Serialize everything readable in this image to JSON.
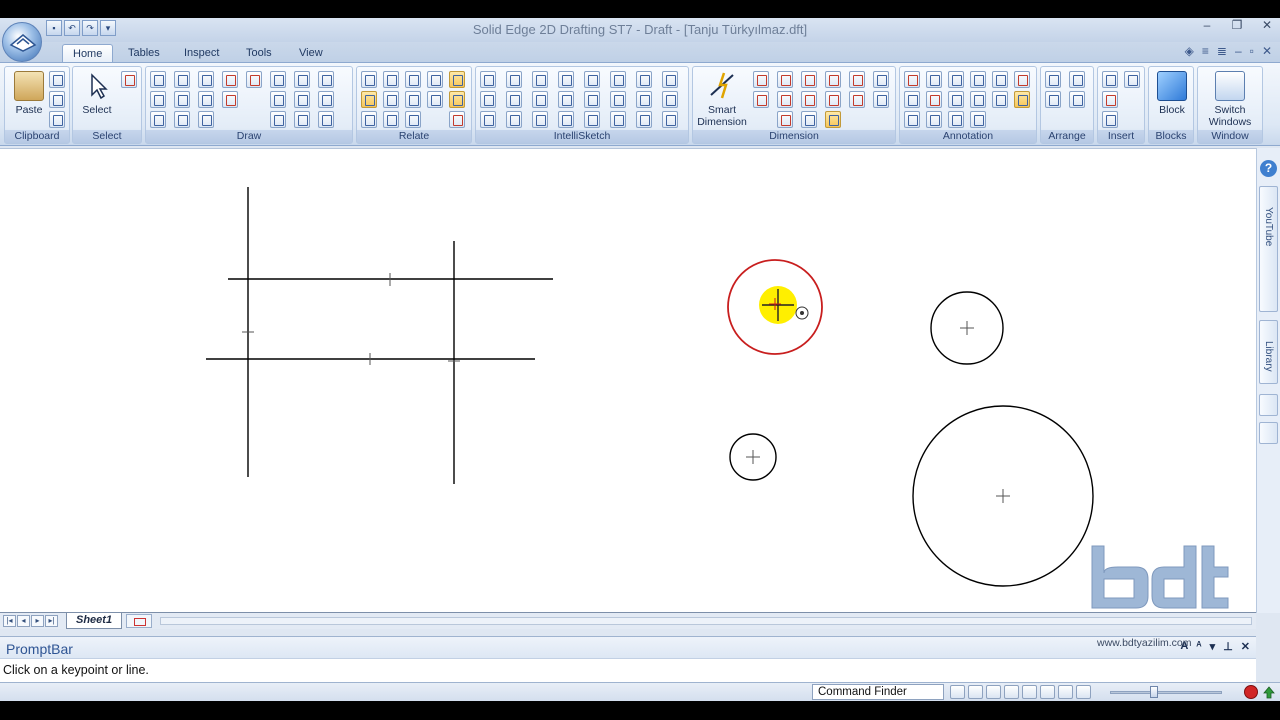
{
  "window": {
    "title": "Solid Edge 2D Drafting ST7 - Draft - [Tanju Türkyılmaz.dft]"
  },
  "tabs": [
    {
      "label": "Home",
      "active": true
    },
    {
      "label": "Tables",
      "active": false
    },
    {
      "label": "Inspect",
      "active": false
    },
    {
      "label": "Tools",
      "active": false
    },
    {
      "label": "View",
      "active": false
    }
  ],
  "ribbon": {
    "clipboard": {
      "label": "Clipboard",
      "paste": "Paste"
    },
    "select": {
      "label": "Select",
      "select": "Select"
    },
    "draw": {
      "label": "Draw"
    },
    "relate": {
      "label": "Relate"
    },
    "intellisketch": {
      "label": "IntelliSketch"
    },
    "dimension": {
      "label": "Dimension",
      "smart1": "Smart",
      "smart2": "Dimension"
    },
    "annotation": {
      "label": "Annotation"
    },
    "arrange": {
      "label": "Arrange"
    },
    "insert": {
      "label": "Insert"
    },
    "blocks": {
      "label": "Blocks",
      "block": "Block"
    },
    "window": {
      "label": "Window",
      "switch1": "Switch",
      "switch2": "Windows"
    }
  },
  "side_tabs": {
    "youtube": "YouTube",
    "library": "Library"
  },
  "sheet": {
    "tab_label": "Sheet1"
  },
  "prompt": {
    "title": "PromptBar",
    "message": "Click on a keypoint or line.",
    "site": "www.bdtyazilim.com"
  },
  "status": {
    "command_finder": "Command Finder"
  },
  "colors": {
    "selected_circle": "#c81e1e",
    "cursor_highlight": "#ffef00",
    "geometry": "#000000"
  }
}
